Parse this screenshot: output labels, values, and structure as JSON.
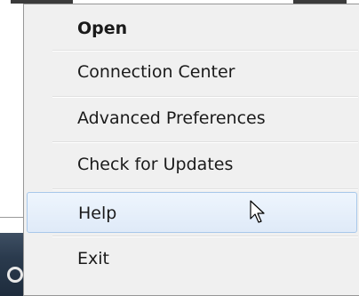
{
  "menu": {
    "items": [
      {
        "label": "Open"
      },
      {
        "label": "Connection Center"
      },
      {
        "label": "Advanced Preferences"
      },
      {
        "label": "Check for Updates"
      },
      {
        "label": "Help"
      },
      {
        "label": "Exit"
      }
    ]
  },
  "colors": {
    "menu_background": "#f0f0f0",
    "hover_background": "#dfeaf8",
    "hover_border": "#a8c8ea",
    "taskbar": "#2a3a4d"
  }
}
